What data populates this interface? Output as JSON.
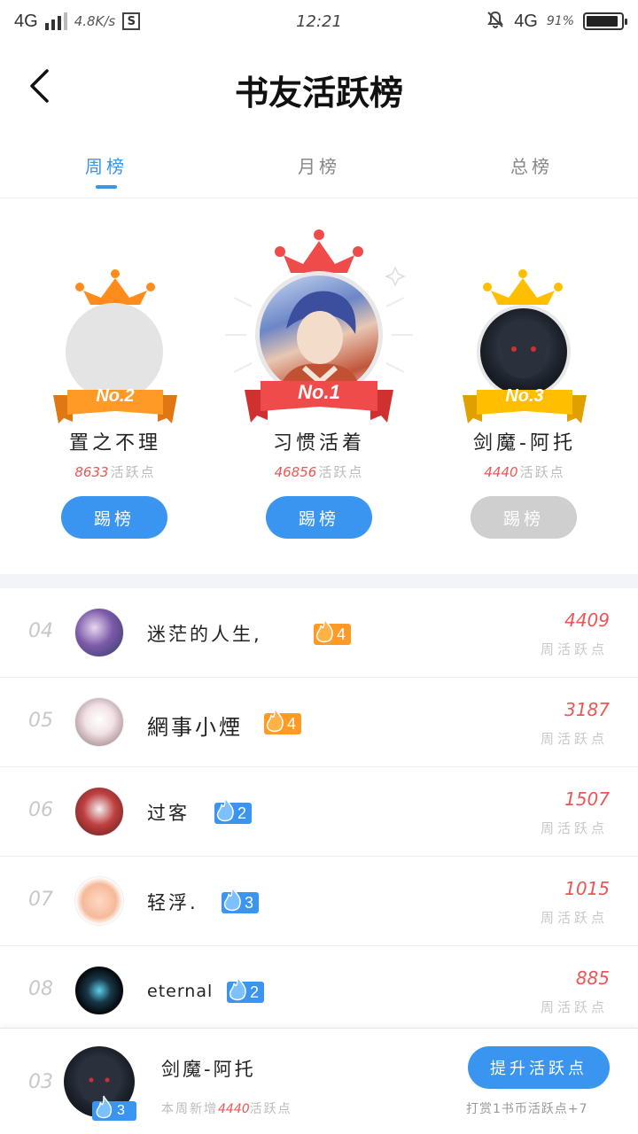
{
  "status_bar": {
    "network": "4G",
    "speed": "4.8K/s",
    "s_icon": "S",
    "time": "12:21",
    "network_right": "4G",
    "battery_text": "91%",
    "battery_level": 0.91,
    "icons": [
      "signal-icon",
      "s-app-icon",
      "bell-off-icon",
      "battery-icon"
    ]
  },
  "header": {
    "title": "书友活跃榜",
    "back_icon": "chevron-left-icon"
  },
  "tabs": [
    {
      "label": "周榜",
      "active": true
    },
    {
      "label": "月榜",
      "active": false
    },
    {
      "label": "总榜",
      "active": false
    }
  ],
  "podium": {
    "first": {
      "badge": "No.1",
      "name": "习惯活着",
      "score": "46856",
      "unit": "活跃点",
      "button": "踢榜",
      "crown_color": "#f04b4b"
    },
    "second": {
      "badge": "No.2",
      "name": "置之不理",
      "score": "8633",
      "unit": "活跃点",
      "button": "踢榜",
      "crown_color": "#ff8c1a"
    },
    "third": {
      "badge": "No.3",
      "name": "剑魔-阿托",
      "score": "4440",
      "unit": "活跃点",
      "button": "踢榜",
      "crown_color": "#ffbf00"
    }
  },
  "list": [
    {
      "rank": "04",
      "name": "迷茫的人生,",
      "level": "4",
      "badge_color": "orange",
      "score": "4409",
      "unit": "周活跃点"
    },
    {
      "rank": "05",
      "name": "網事小煙",
      "level": "4",
      "badge_color": "orange",
      "score": "3187",
      "unit": "周活跃点"
    },
    {
      "rank": "06",
      "name": "过客",
      "level": "2",
      "badge_color": "blue",
      "score": "1507",
      "unit": "周活跃点"
    },
    {
      "rank": "07",
      "name": "轻浮.",
      "level": "3",
      "badge_color": "blue",
      "score": "1015",
      "unit": "周活跃点"
    },
    {
      "rank": "08",
      "name": "eternal",
      "level": "2",
      "badge_color": "blue",
      "score": "885",
      "unit": "周活跃点"
    }
  ],
  "self": {
    "rank": "03",
    "name": "剑魔-阿托",
    "level": "3",
    "week_prefix": "本周新增",
    "week_score": "4440",
    "week_suffix": "活跃点",
    "button": "提升活跃点",
    "reward_text": "打赏1书币活跃点+7"
  },
  "colors": {
    "accent": "#3896ee",
    "score_red": "#e55555",
    "gray_button": "#cfcfcf"
  }
}
